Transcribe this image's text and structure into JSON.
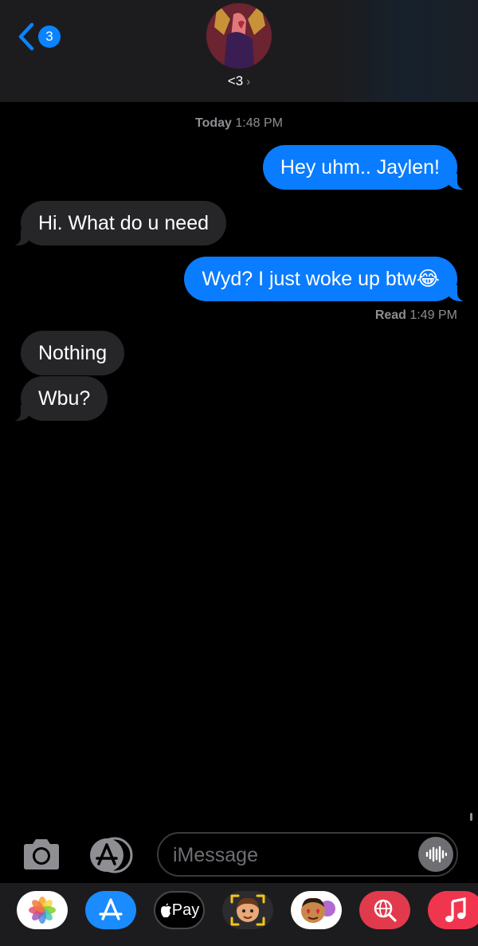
{
  "header": {
    "back_badge_count": "3",
    "contact_name": "<3",
    "contact_chevron": "›"
  },
  "conversation": {
    "timestamp": {
      "day": "Today",
      "time": "1:48 PM"
    },
    "messages": [
      {
        "direction": "outgoing",
        "text": "Hey uhm.. Jaylen!"
      },
      {
        "direction": "incoming",
        "text": "Hi. What do u need"
      },
      {
        "direction": "outgoing",
        "text": "Wyd? I just woke up btw😂"
      },
      {
        "direction": "incoming",
        "text": "Nothing"
      },
      {
        "direction": "incoming",
        "text": "Wbu?"
      }
    ],
    "read_receipt": {
      "status": "Read",
      "time": "1:49 PM"
    }
  },
  "composer": {
    "placeholder": "iMessage"
  },
  "app_drawer": {
    "items": [
      {
        "name": "photos-app",
        "icon": "photos-icon"
      },
      {
        "name": "app-store-app",
        "icon": "app-store-icon"
      },
      {
        "name": "apple-pay-app",
        "icon": "apple-pay-icon",
        "label": "Pay"
      },
      {
        "name": "memoji-app",
        "icon": "memoji-icon"
      },
      {
        "name": "memoji-stickers-app",
        "icon": "stickers-icon"
      },
      {
        "name": "image-search-app",
        "icon": "globe-search-icon"
      },
      {
        "name": "music-app",
        "icon": "music-note-icon"
      }
    ]
  },
  "colors": {
    "outgoing_bubble": "#0a7cff",
    "incoming_bubble": "#262629",
    "accent": "#0a84ff",
    "background": "#000000"
  }
}
